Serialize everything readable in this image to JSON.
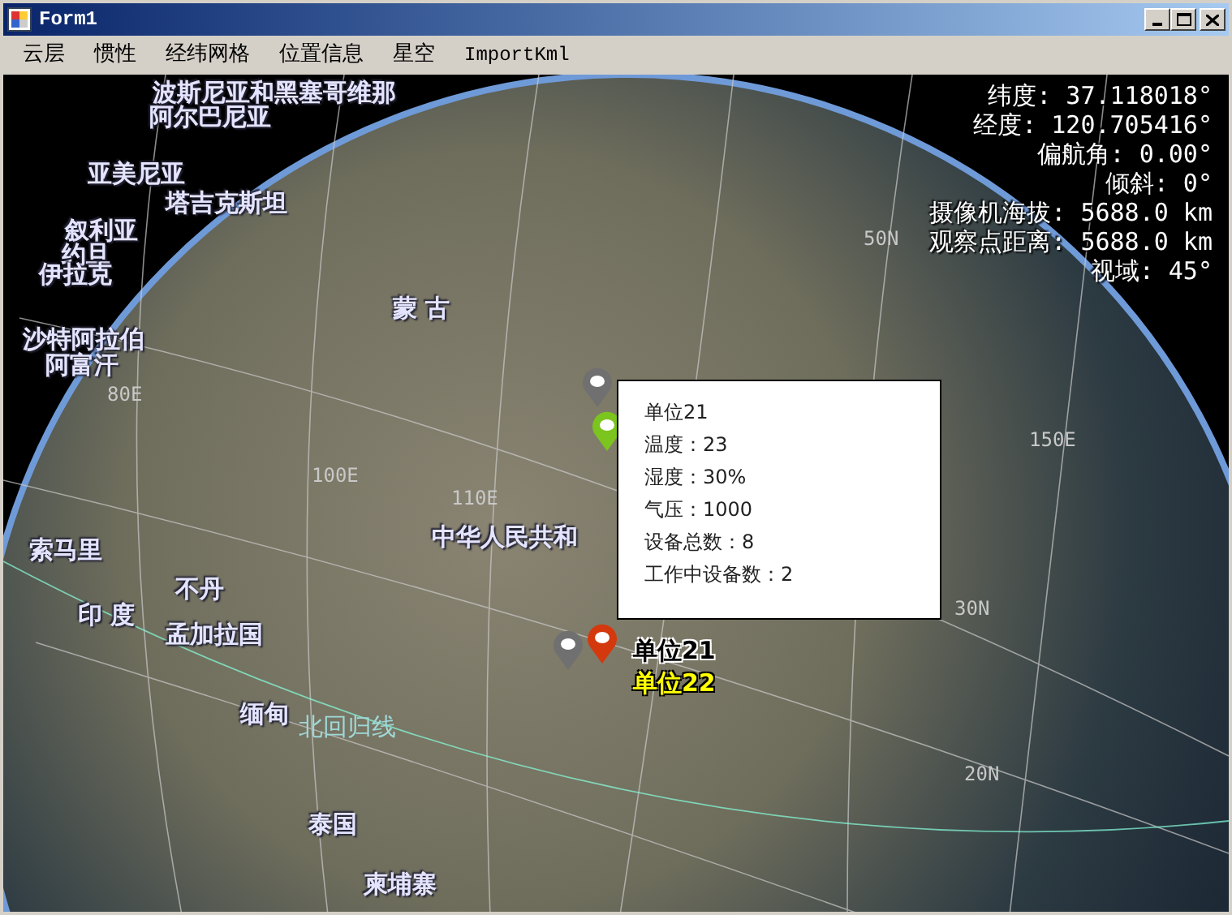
{
  "window": {
    "title": "Form1"
  },
  "menu": [
    "云层",
    "惯性",
    "经纬网格",
    "位置信息",
    "星空",
    "ImportKml"
  ],
  "hud": [
    "纬度: 37.118018°",
    "经度: 120.705416°",
    "偏航角: 0.00°",
    "倾斜: 0°",
    "摄像机海拔: 5688.0 km",
    "观察点距离: 5688.0 km",
    "视域: 45°"
  ],
  "place_labels": [
    {
      "text": "波斯尼亚和黑塞哥维那",
      "kind": "country"
    },
    {
      "text": "阿尔巴尼亚",
      "kind": "country"
    },
    {
      "text": "亚美尼亚",
      "kind": "country"
    },
    {
      "text": "塔吉克斯坦",
      "kind": "country"
    },
    {
      "text": "叙利亚",
      "kind": "country"
    },
    {
      "text": "约旦",
      "kind": "country"
    },
    {
      "text": "伊拉克",
      "kind": "country"
    },
    {
      "text": "沙特阿拉伯",
      "kind": "country"
    },
    {
      "text": "阿富汗",
      "kind": "country"
    },
    {
      "text": "蒙 古",
      "kind": "country"
    },
    {
      "text": "索马里",
      "kind": "country"
    },
    {
      "text": "印 度",
      "kind": "country"
    },
    {
      "text": "不丹",
      "kind": "country"
    },
    {
      "text": "孟加拉国",
      "kind": "country"
    },
    {
      "text": "缅甸",
      "kind": "country"
    },
    {
      "text": "泰国",
      "kind": "country"
    },
    {
      "text": "柬埔寨",
      "kind": "country"
    },
    {
      "text": "中华人民共和",
      "kind": "country"
    },
    {
      "text": "北回归线",
      "kind": "tropic"
    },
    {
      "text": "80E",
      "kind": "grid"
    },
    {
      "text": "100E",
      "kind": "grid"
    },
    {
      "text": "110E",
      "kind": "grid"
    },
    {
      "text": "50N",
      "kind": "grid"
    },
    {
      "text": "150E",
      "kind": "grid"
    },
    {
      "text": "30N",
      "kind": "grid"
    },
    {
      "text": "20N",
      "kind": "grid"
    }
  ],
  "markers": [
    {
      "color": "#7cc41e"
    },
    {
      "color": "#707070"
    },
    {
      "color": "#707070"
    },
    {
      "color": "#d4380d"
    }
  ],
  "marker_labels": [
    {
      "text": "单位21",
      "kind": "dark"
    },
    {
      "text": "单位22",
      "kind": "yellow"
    }
  ],
  "popup": {
    "lines": [
      "单位21",
      "温度：23",
      "湿度：30%",
      "气压：1000",
      "设备总数：8",
      "工作中设备数：2"
    ]
  }
}
